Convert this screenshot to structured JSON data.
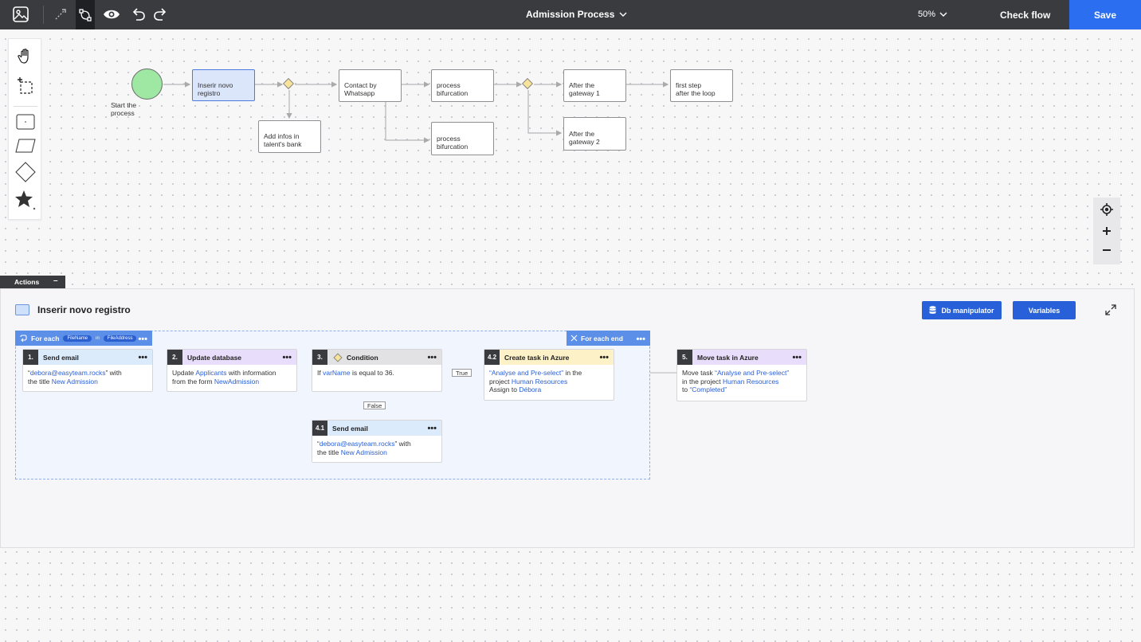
{
  "header": {
    "title": "Admission Process",
    "zoom": "50%",
    "check_flow": "Check flow",
    "save": "Save"
  },
  "diagram": {
    "start_label": "Start the\nprocess",
    "nodes": {
      "inserir": "Inserir novo\nregistro",
      "add_infos": "Add infos in\ntalent's bank",
      "contact": "Contact by\nWhatsapp",
      "bif1": "process\nbifurcation",
      "bif2": "process\nbifurcation",
      "after1": "After the\ngateway 1",
      "after2": "After the\ngateway 2",
      "first_step": "first step\nafter the loop"
    }
  },
  "actions_tab": {
    "label": "Actions",
    "collapse": "–"
  },
  "panel": {
    "title": "Inserir novo registro",
    "db_button": "Db manipulator",
    "variables_button": "Variables",
    "foreach": {
      "label": "For each",
      "chip1": "FileName",
      "in": "in",
      "chip2": "FileAddress",
      "end_label": "For each end"
    },
    "cards": {
      "c1": {
        "num": "1.",
        "title": "Send email",
        "q1": "“",
        "email": "debora@easyteam.rocks",
        "q2": "” with",
        "line2a": "the title ",
        "line2b": "New Admission"
      },
      "c2": {
        "num": "2.",
        "title": "Update database",
        "a": "Update ",
        "b": "Applicants",
        "c": " with information",
        "d": "from the form ",
        "e": "NewAdmission"
      },
      "c3": {
        "num": "3.",
        "title": "Condition",
        "a": "If ",
        "b": "varName",
        "c": " is equal to 36."
      },
      "c41": {
        "num": "4.1",
        "title": "Send email",
        "q1": "“",
        "email": "debora@easyteam.rocks",
        "q2": "” with",
        "line2a": "the title ",
        "line2b": "New Admission"
      },
      "c42": {
        "num": "4.2",
        "title": "Create task in Azure",
        "a": "“Analyse and Pre-select”",
        "b": " in the",
        "c": "project ",
        "d": "Human Resources",
        "e": "Assign to ",
        "f": "Débora"
      },
      "c5": {
        "num": "5.",
        "title": "Move task in Azure",
        "a": "Move task ",
        "b": "“Analyse and Pre-select”",
        "c": "in the project ",
        "d": "Human Resources",
        "e": "to ",
        "f": "“Completed”"
      }
    },
    "true_label": "True",
    "false_label": "False"
  }
}
